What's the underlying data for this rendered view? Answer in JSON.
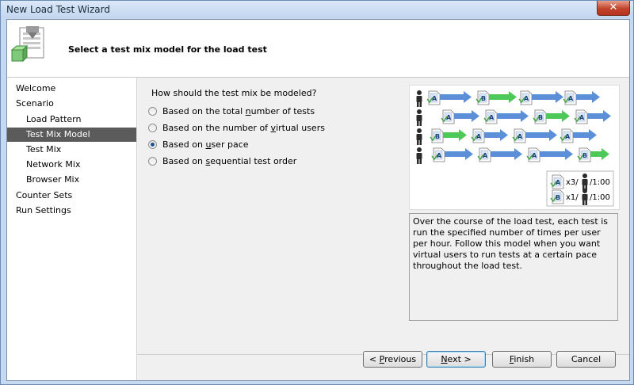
{
  "window": {
    "title": "New Load Test Wizard",
    "close_glyph": "✕"
  },
  "header": {
    "title": "Select a test mix model for the load test",
    "icon": "wizard-document-icon"
  },
  "nav": {
    "items": [
      {
        "label": "Welcome"
      },
      {
        "label": "Scenario"
      },
      {
        "label": "Load Pattern"
      },
      {
        "label": "Test Mix Model",
        "selected": true
      },
      {
        "label": "Test Mix"
      },
      {
        "label": "Network Mix"
      },
      {
        "label": "Browser Mix"
      },
      {
        "label": "Counter Sets"
      },
      {
        "label": "Run Settings"
      }
    ]
  },
  "main": {
    "question": "How should the test mix be modeled?",
    "options": [
      {
        "pre": "Based on the total ",
        "mnemonic": "n",
        "post": "umber of tests",
        "checked": false
      },
      {
        "pre": "Based on the number of ",
        "mnemonic": "v",
        "post": "irtual users",
        "checked": false
      },
      {
        "pre": "Based on ",
        "mnemonic": "u",
        "post": "ser pace",
        "checked": true
      },
      {
        "pre": "Based on ",
        "mnemonic": "s",
        "post": "equential test order",
        "checked": false
      }
    ],
    "legend": [
      {
        "test": "A",
        "text": "x3/",
        "rate": "/1:00"
      },
      {
        "test": "B",
        "text": "x1/",
        "rate": "/1:00"
      }
    ],
    "description": "Over the course of the load test, each test is run the specified number of times per user per hour. Follow this model when you want virtual users to run tests at a certain pace throughout the load test."
  },
  "buttons": {
    "previous": {
      "pre": "< ",
      "mnemonic": "P",
      "post": "revious"
    },
    "next": {
      "pre": "",
      "mnemonic": "N",
      "post": "ext >"
    },
    "finish": {
      "pre": "",
      "mnemonic": "F",
      "post": "inish"
    },
    "cancel": {
      "label": "Cancel"
    }
  },
  "colors": {
    "selected_nav": "#5b5b5b",
    "blue_arrow": "#5b8fd8",
    "green_arrow": "#4fc85a",
    "title_bar": "#c5d9f1"
  }
}
